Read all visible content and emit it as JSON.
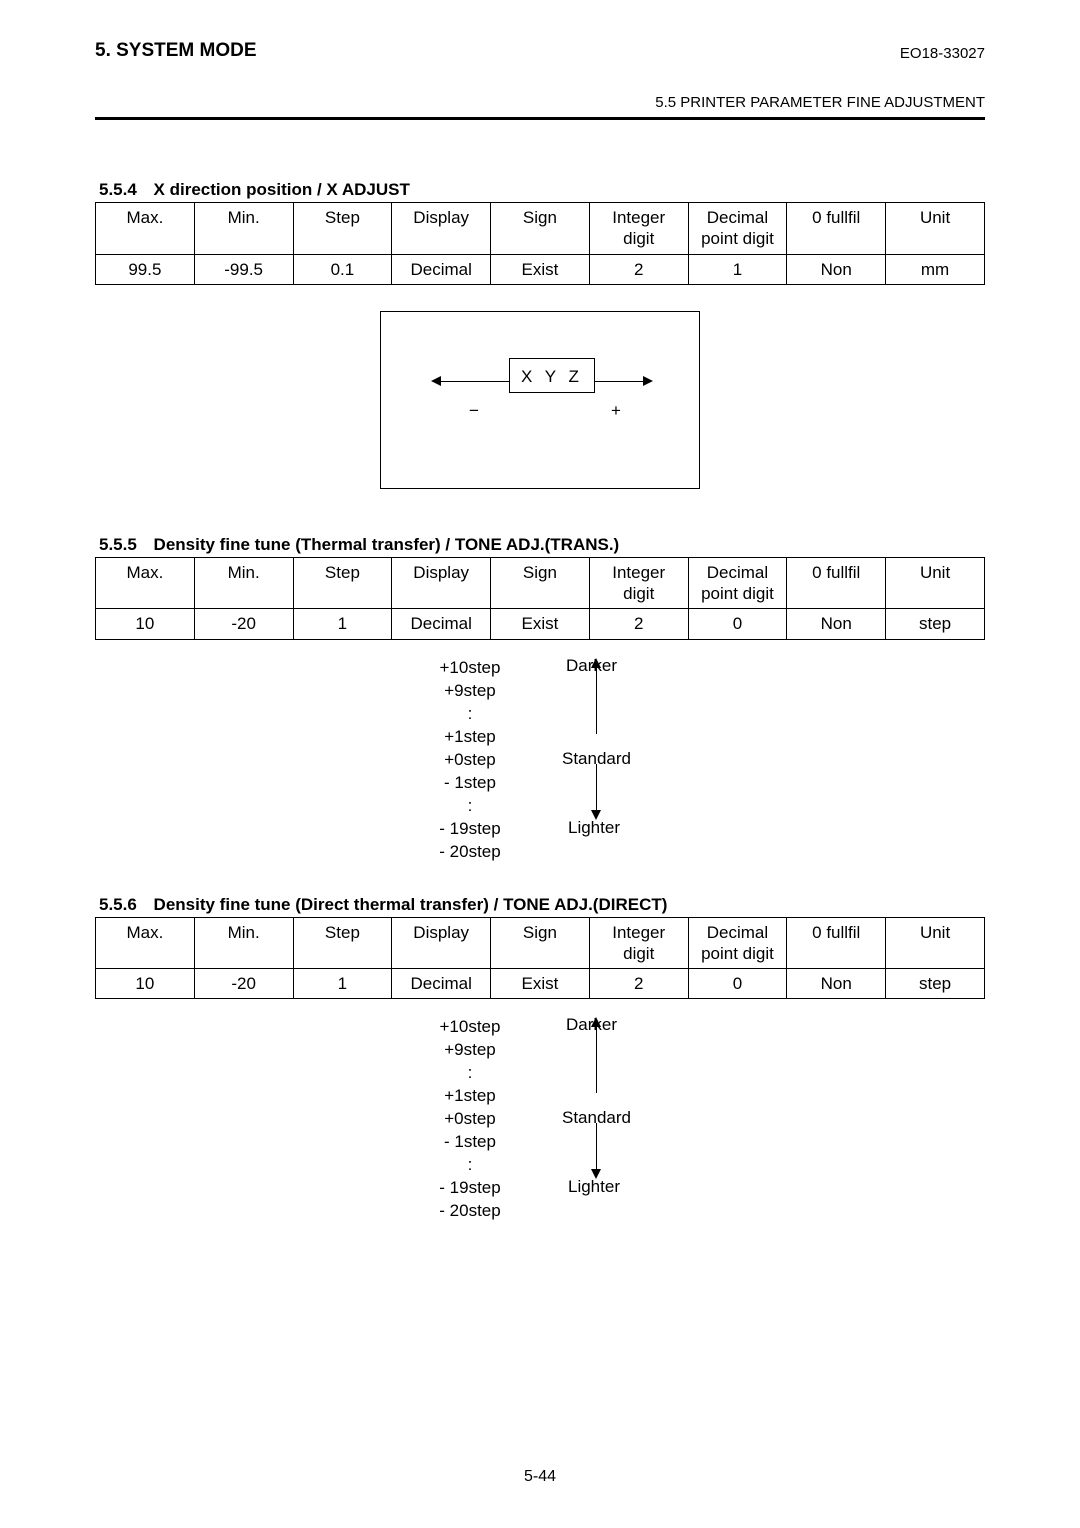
{
  "header": {
    "section": "5. SYSTEM MODE",
    "docnum": "EO18-33027",
    "subtitle": "5.5 PRINTER PARAMETER FINE ADJUSTMENT"
  },
  "columns": {
    "max": "Max.",
    "min": "Min.",
    "step": "Step",
    "display": "Display",
    "sign": "Sign",
    "int_digit": "Integer digit",
    "dec_digit": "Decimal point digit",
    "fullfil": "0 fullfil",
    "unit": "Unit"
  },
  "s554": {
    "num": "5.5.4",
    "title": "X direction position / X ADJUST",
    "row": {
      "max": "99.5",
      "min": "-99.5",
      "step": "0.1",
      "display": "Decimal",
      "sign": "Exist",
      "int": "2",
      "dec": "1",
      "full": "Non",
      "unit": "mm"
    },
    "diagram": {
      "label": "X Y Z",
      "minus": "−",
      "plus": "+"
    }
  },
  "s555": {
    "num": "5.5.5",
    "title": "Density fine tune (Thermal transfer) / TONE ADJ.(TRANS.)",
    "row": {
      "max": "10",
      "min": "-20",
      "step": "1",
      "display": "Decimal",
      "sign": "Exist",
      "int": "2",
      "dec": "0",
      "full": "Non",
      "unit": "step"
    }
  },
  "s556": {
    "num": "5.5.6",
    "title": "Density fine tune (Direct thermal transfer) / TONE ADJ.(DIRECT)",
    "row": {
      "max": "10",
      "min": "-20",
      "step": "1",
      "display": "Decimal",
      "sign": "Exist",
      "int": "2",
      "dec": "0",
      "full": "Non",
      "unit": "step"
    }
  },
  "tone": {
    "darker": "Darker",
    "standard": "Standard",
    "lighter": "Lighter",
    "steps": [
      "+10step",
      "+9step",
      ":",
      "+1step",
      "+0step",
      "- 1step",
      ":",
      "- 19step",
      "- 20step"
    ]
  },
  "footer": "5-44"
}
